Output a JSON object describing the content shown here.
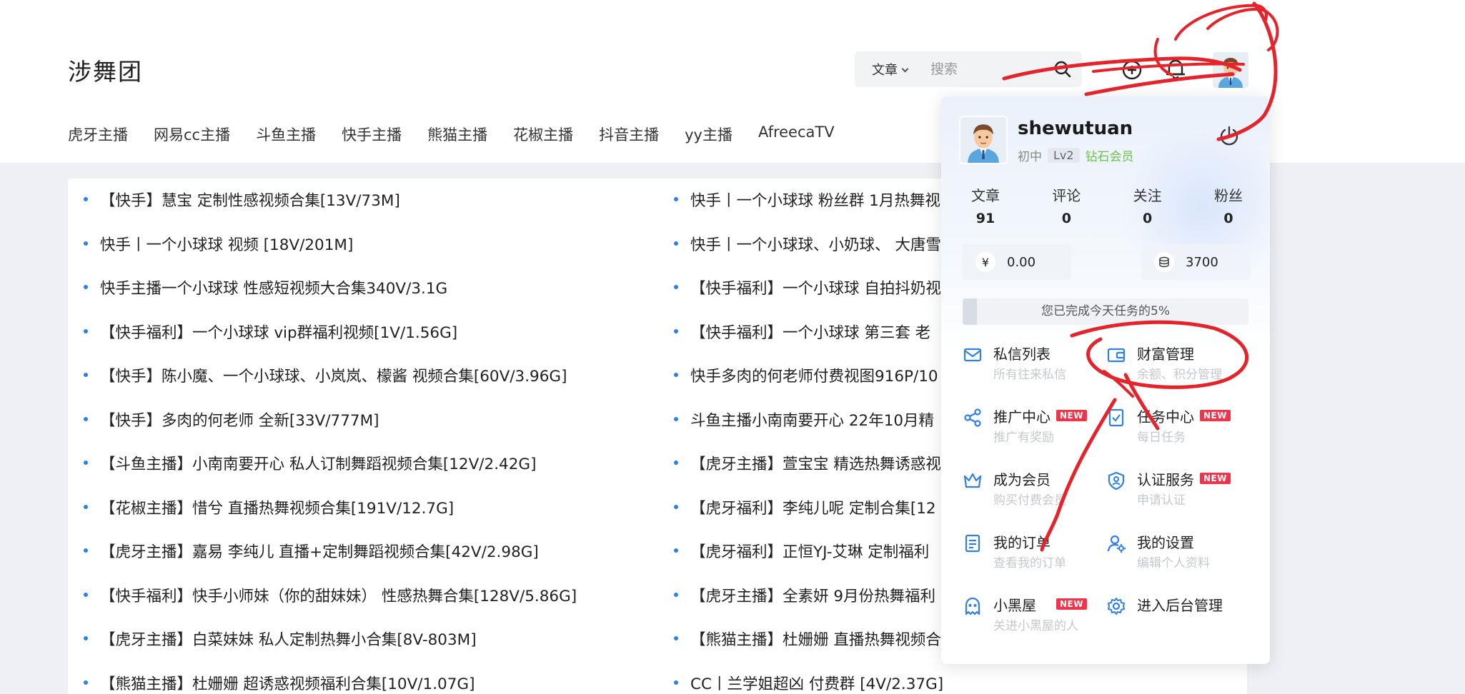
{
  "site": {
    "logo": "涉舞团"
  },
  "nav": [
    "虎牙主播",
    "网易cc主播",
    "斗鱼主播",
    "快手主播",
    "熊猫主播",
    "花椒主播",
    "抖音主播",
    "yy主播",
    "AfreecaTV"
  ],
  "search": {
    "type_label": "文章",
    "placeholder": "搜索"
  },
  "posts": {
    "left": [
      "【快手】慧宝 定制性感视频合集[13V/73M]",
      "快手丨一个小球球 视频 [18V/201M]",
      "快手主播一个小球球 性感短视频大合集340V/3.1G",
      "【快手福利】一个小球球 vip群福利视频[1V/1.56G]",
      "【快手】陈小魔、一个小球球、小岚岚、檬酱 视频合集[60V/3.96G]",
      "【快手】多肉的何老师 全新[33V/777M]",
      "【斗鱼主播】小南南要开心 私人订制舞蹈视频合集[12V/2.42G]",
      "【花椒主播】惜兮 直播热舞视频合集[191V/12.7G]",
      "【虎牙主播】嘉易 李纯儿 直播+定制舞蹈视频合集[42V/2.98G]",
      "【快手福利】快手小师妹（你的甜妹妹） 性感热舞合集[128V/5.86G]",
      "【虎牙主播】白菜妹妹 私人定制热舞小合集[8V-803M]",
      "【熊猫主播】杜姗姗 超诱惑视频福利合集[10V/1.07G]"
    ],
    "right": [
      "快手丨一个小球球 粉丝群 1月热舞视",
      "快手丨一个小球球、小奶球、 大唐雪",
      "【快手福利】一个小球球 自拍抖奶视",
      "【快手福利】一个小球球 第三套 老",
      "快手多肉的何老师付费视图916P/10",
      "斗鱼主播小南南要开心 22年10月精",
      "【虎牙主播】萱宝宝 精选热舞诱惑视",
      "【虎牙福利】李纯儿呢 定制合集[12",
      "【虎牙福利】正恒YJ-艾琳 定制福利",
      "【虎牙主播】全素妍 9月份热舞福利",
      "【熊猫主播】杜姗姗 直播热舞视频合",
      "CC丨兰学姐超凶 付费群 [4V/2.37G]"
    ]
  },
  "user_panel": {
    "username": "shewutuan",
    "rank": "初中",
    "level": "Lv2",
    "vip": "钻石会员",
    "stats": [
      {
        "label": "文章",
        "value": "91"
      },
      {
        "label": "评论",
        "value": "0"
      },
      {
        "label": "关注",
        "value": "0"
      },
      {
        "label": "粉丝",
        "value": "0"
      }
    ],
    "balance": {
      "currency_symbol": "¥",
      "money": "0.00",
      "coins": "3700"
    },
    "task": {
      "text": "您已完成今天任务的5%",
      "progress_percent": 5
    },
    "menu": [
      {
        "title": "私信列表",
        "sub": "所有往来私信",
        "badge": ""
      },
      {
        "title": "财富管理",
        "sub": "余额、积分管理",
        "badge": ""
      },
      {
        "title": "推广中心",
        "sub": "推广有奖励",
        "badge": "NEW"
      },
      {
        "title": "任务中心",
        "sub": "每日任务",
        "badge": "NEW"
      },
      {
        "title": "成为会员",
        "sub": "购买付费会员",
        "badge": ""
      },
      {
        "title": "认证服务",
        "sub": "申请认证",
        "badge": "NEW"
      },
      {
        "title": "我的订单",
        "sub": "查看我的订单",
        "badge": ""
      },
      {
        "title": "我的设置",
        "sub": "编辑个人资料",
        "badge": ""
      },
      {
        "title": "小黑屋",
        "sub": "关进小黑屋的人",
        "badge": "NEW"
      },
      {
        "title": "进入后台管理",
        "sub": "",
        "badge": ""
      }
    ]
  },
  "colors": {
    "accent": "#2f7fe6",
    "vip": "#6fc24a",
    "badge": "#f2334a",
    "annotation": "#e5232b"
  },
  "icons": [
    "search-icon",
    "add-circle-icon",
    "bell-icon",
    "logout-icon",
    "mail-icon",
    "wallet-icon",
    "share-icon",
    "task-icon",
    "crown-icon",
    "shield-user-icon",
    "order-icon",
    "user-settings-icon",
    "ghost-icon",
    "gear-icon",
    "yuan-icon",
    "coins-icon"
  ]
}
